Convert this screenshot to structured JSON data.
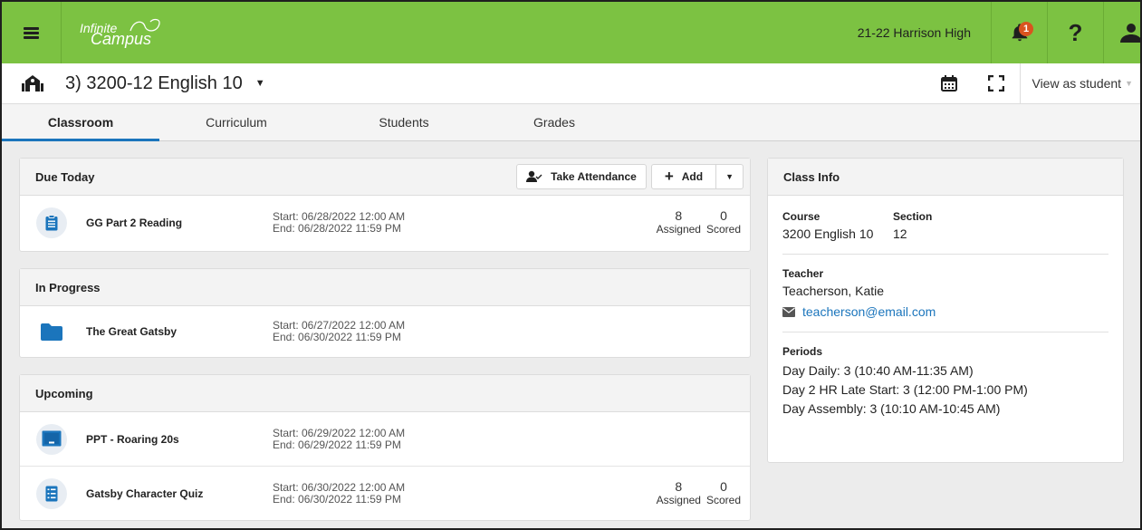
{
  "topbar": {
    "logo_line1": "Infinite",
    "logo_line2": "Campus",
    "school": "21-22 Harrison High",
    "notification_count": "1",
    "help_label": "?"
  },
  "course": {
    "title": "3) 3200-12 English 10",
    "view_as": "View as student"
  },
  "tabs": [
    {
      "label": "Classroom",
      "active": true
    },
    {
      "label": "Curriculum"
    },
    {
      "label": "Students"
    },
    {
      "label": "Grades"
    }
  ],
  "due_today": {
    "title": "Due Today",
    "take_attendance": "Take Attendance",
    "add": "Add",
    "items": [
      {
        "name": "GG Part 2 Reading",
        "start": "Start: 06/28/2022 12:00 AM",
        "end": "End: 06/28/2022 11:59 PM",
        "assigned": "8",
        "scored": "0",
        "assigned_label": "Assigned",
        "scored_label": "Scored",
        "icon": "clipboard-icon"
      }
    ]
  },
  "in_progress": {
    "title": "In Progress",
    "items": [
      {
        "name": "The Great Gatsby",
        "start": "Start: 06/27/2022 12:00 AM",
        "end": "End: 06/30/2022 11:59 PM",
        "icon": "folder-icon"
      }
    ]
  },
  "upcoming": {
    "title": "Upcoming",
    "items": [
      {
        "name": "PPT - Roaring 20s",
        "start": "Start: 06/29/2022 12:00 AM",
        "end": "End: 06/29/2022 11:59 PM",
        "icon": "presentation-icon"
      },
      {
        "name": "Gatsby Character Quiz",
        "start": "Start: 06/30/2022 12:00 AM",
        "end": "End: 06/30/2022 11:59 PM",
        "assigned": "8",
        "scored": "0",
        "assigned_label": "Assigned",
        "scored_label": "Scored",
        "icon": "quiz-icon"
      }
    ]
  },
  "class_info": {
    "title": "Class Info",
    "course_label": "Course",
    "course_value": "3200 English 10",
    "section_label": "Section",
    "section_value": "12",
    "teacher_label": "Teacher",
    "teacher_name": "Teacherson, Katie",
    "teacher_email": "teacherson@email.com",
    "periods_label": "Periods",
    "periods": [
      "Day Daily: 3 (10:40 AM-11:35 AM)",
      "Day 2 HR Late Start: 3 (12:00 PM-1:00 PM)",
      "Day Assembly: 3 (10:10 AM-10:45 AM)"
    ]
  },
  "colors": {
    "topbar": "#7cc242",
    "accent": "#1b75bc",
    "badge": "#d9541f"
  }
}
